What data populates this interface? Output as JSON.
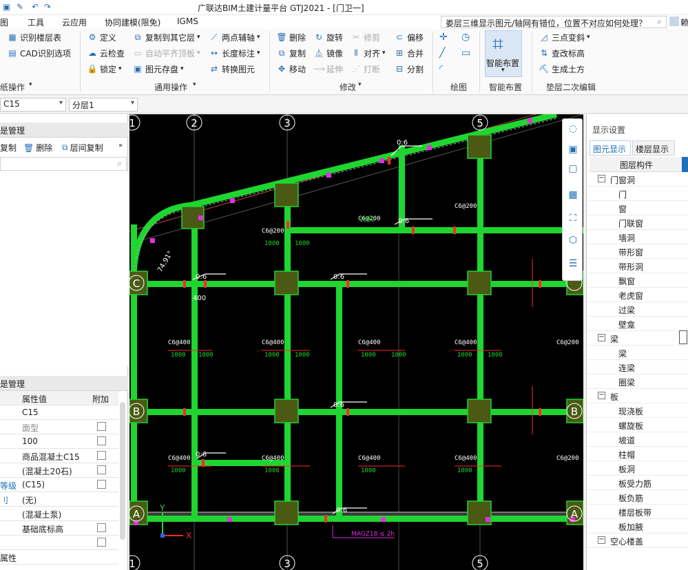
{
  "titlebar": {
    "app_title": "广联达BIM土建计量平台 GTJ2021 - [门卫一]",
    "help_query": "娄层三维显示图元/轴网有错位，位置不对应如何处理？",
    "user_label": "赖"
  },
  "menubar": {
    "items": [
      "图",
      "工具",
      "云应用",
      "协同建模(限免)",
      "IGMS"
    ]
  },
  "ribbon": {
    "drawing_ops": {
      "items": [
        "识别楼层表",
        "CAD识别选项"
      ],
      "group_label": "纸操作"
    },
    "general_ops": {
      "items": [
        "定义",
        "云检查",
        "锁定",
        "复制到其它层",
        "自动平齐顶板",
        "图元存盘",
        "两点辅轴",
        "长度标注",
        "转换图元"
      ],
      "group_label": "通用操作"
    },
    "modify": {
      "items": [
        "删除",
        "复制",
        "移动",
        "旋转",
        "镜像",
        "延伸",
        "修剪",
        "对齐",
        "打断",
        "偏移",
        "合并",
        "分割"
      ],
      "group_label": "修改"
    },
    "draw": {
      "group_label": "绘图"
    },
    "smart_layout": {
      "button_label": "智能布置",
      "group_label": "智能布置"
    },
    "cushion_edit": {
      "items": [
        "三点变斜",
        "查改标高",
        "生成土方"
      ],
      "group_label": "垫层二次编辑"
    }
  },
  "selectors": {
    "element_name": "C15",
    "sublayer": "分层1"
  },
  "left_panel": {
    "component_header": "是管理",
    "toolbar": [
      "复制",
      "删除",
      "层间复制"
    ],
    "search_placeholder": "",
    "property_header": "是管理",
    "columns": [
      "",
      "属性值",
      "附加"
    ],
    "rows": [
      {
        "name": "",
        "value": "C15",
        "check": false
      },
      {
        "name": "",
        "value": "面型",
        "check": true
      },
      {
        "name": "",
        "value": "100",
        "check": true
      },
      {
        "name": "",
        "value": "商品混凝土C15",
        "check": true
      },
      {
        "name": "",
        "value": "(混凝土20石)",
        "check": true
      },
      {
        "name": "等级",
        "value": "(C15)",
        "check": true
      },
      {
        "name": "刂",
        "value": "(无)",
        "check": false
      },
      {
        "name": "",
        "value": "(混凝土泵)",
        "check": false
      },
      {
        "name": "",
        "value": "基础底标高",
        "check": true
      },
      {
        "name": "",
        "value": "",
        "check": true
      },
      {
        "name": "属性",
        "value": "",
        "check": false
      }
    ]
  },
  "canvas": {
    "axis_top": [
      "1",
      "2",
      "3",
      "5"
    ],
    "axis_bottom": [
      "1",
      "3",
      "5"
    ],
    "axis_side": [
      "C",
      "B",
      "A"
    ],
    "beam_label": "C6@200",
    "beam_label2": "C6@400",
    "dim_label": "1000",
    "slope_label": "0:6",
    "angle_label": "74.91°",
    "offset_label": "400",
    "magenta_label": "MAGZ18 ≤ 2h",
    "coord_x": "X",
    "coord_y": "Y"
  },
  "right_panel": {
    "header": "显示设置",
    "tabs": [
      "图元显示",
      "楼层显示"
    ],
    "column_header": "图层构件",
    "tree": [
      {
        "label": "门窗洞",
        "group": true
      },
      {
        "label": "门",
        "group": false
      },
      {
        "label": "窗",
        "group": false
      },
      {
        "label": "门联窗",
        "group": false
      },
      {
        "label": "墙洞",
        "group": false
      },
      {
        "label": "带形窗",
        "group": false
      },
      {
        "label": "带形洞",
        "group": false
      },
      {
        "label": "飘窗",
        "group": false
      },
      {
        "label": "老虎窗",
        "group": false
      },
      {
        "label": "过梁",
        "group": false
      },
      {
        "label": "壁龛",
        "group": false
      },
      {
        "label": "梁",
        "group": true
      },
      {
        "label": "梁",
        "group": false
      },
      {
        "label": "连梁",
        "group": false
      },
      {
        "label": "圈梁",
        "group": false
      },
      {
        "label": "板",
        "group": true
      },
      {
        "label": "现浇板",
        "group": false
      },
      {
        "label": "螺旋板",
        "group": false
      },
      {
        "label": "坡道",
        "group": false
      },
      {
        "label": "柱帽",
        "group": false
      },
      {
        "label": "板洞",
        "group": false
      },
      {
        "label": "板受力筋",
        "group": false
      },
      {
        "label": "板负筋",
        "group": false
      },
      {
        "label": "楼层板带",
        "group": false
      },
      {
        "label": "板加腋",
        "group": false
      },
      {
        "label": "空心楼盖",
        "group": true
      }
    ]
  },
  "colors": {
    "canvas_bg": "#000000",
    "beam_green": "#1fd631",
    "column_dark": "#4a5a14",
    "dim_red": "#ff2a2a",
    "tab_active": "#1f6fb8"
  }
}
